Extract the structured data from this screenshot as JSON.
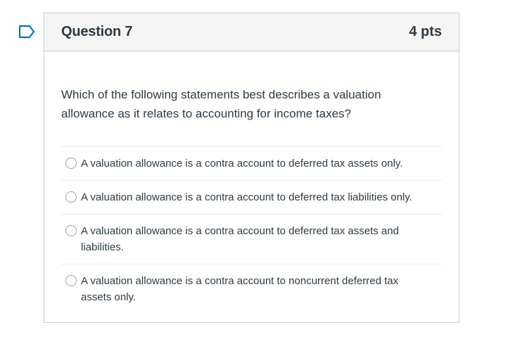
{
  "question": {
    "title": "Question 7",
    "points": "4 pts",
    "prompt": "Which of the following statements best describes a valuation allowance as it relates to accounting for income taxes?",
    "answers": [
      {
        "label": "A valuation allowance is a contra account to deferred tax assets only."
      },
      {
        "label": "A valuation allowance is a contra account to deferred tax liabilities only."
      },
      {
        "label": "A valuation allowance is a contra account to deferred tax assets and liabilities."
      },
      {
        "label": "A valuation allowance is a contra account to noncurrent deferred tax assets only."
      }
    ]
  },
  "icons": {
    "flag": "flag-outline-icon"
  },
  "colors": {
    "flag": "#0374b5",
    "text": "#2d3b45",
    "header_bg": "#f5f5f5",
    "border": "#c7cdd1"
  }
}
